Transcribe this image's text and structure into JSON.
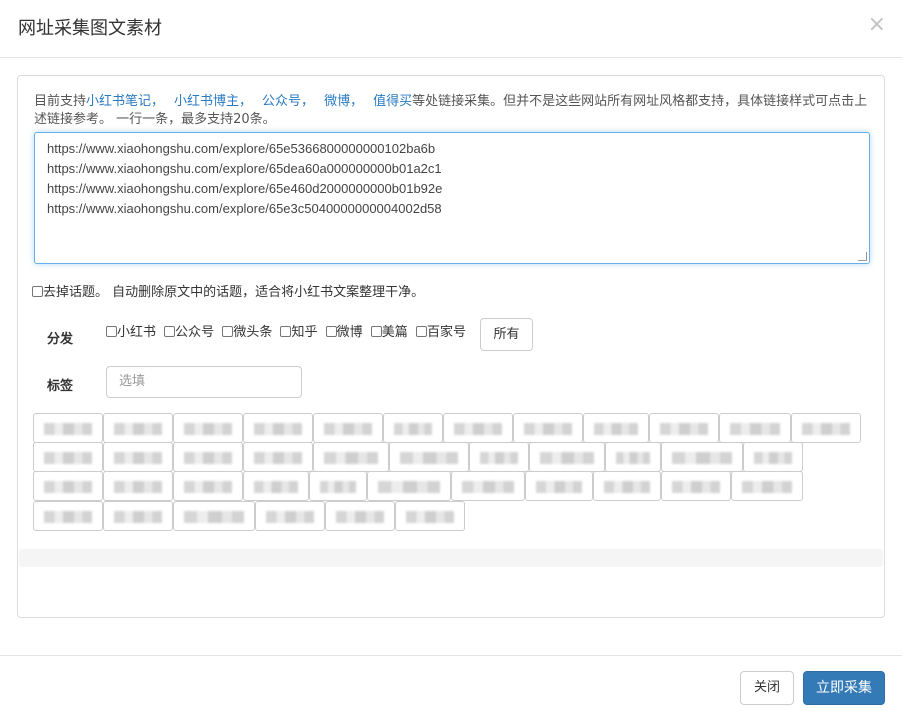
{
  "modal": {
    "title": "网址采集图文素材",
    "close_glyph": "×"
  },
  "info": {
    "prefix": "目前支持",
    "links": [
      "小红书笔记，",
      "小红书博主，",
      "公众号，",
      "微博，",
      "值得买"
    ],
    "suffix": "等处链接采集。但并不是这些网站所有网址风格都支持，具体链接样式可点击上述链接参考。 一行一条，最多支持20条。"
  },
  "urls": [
    "https://www.xiaohongshu.com/explore/65e5366800000000102ba6b",
    "https://www.xiaohongshu.com/explore/65dea60a000000000b01a2c1",
    "https://www.xiaohongshu.com/explore/65e460d2000000000b01b92e",
    "https://www.xiaohongshu.com/explore/65e3c5040000000004002d58"
  ],
  "remove_topic": {
    "label": "去掉话题。 自动删除原文中的话题，适合将小红书文案整理干净。"
  },
  "distribute": {
    "label": "分发",
    "options": [
      "小红书",
      "公众号",
      "微头条",
      "知乎",
      "微博",
      "美篇",
      "百家号"
    ],
    "all_button": "所有"
  },
  "tags": {
    "label": "标签",
    "placeholder": "选填"
  },
  "footer": {
    "close_label": "关闭",
    "submit_label": "立即采集"
  },
  "colors": {
    "primary": "#337ab7",
    "link": "#2a7ac2",
    "focus_border": "#66afe9"
  }
}
